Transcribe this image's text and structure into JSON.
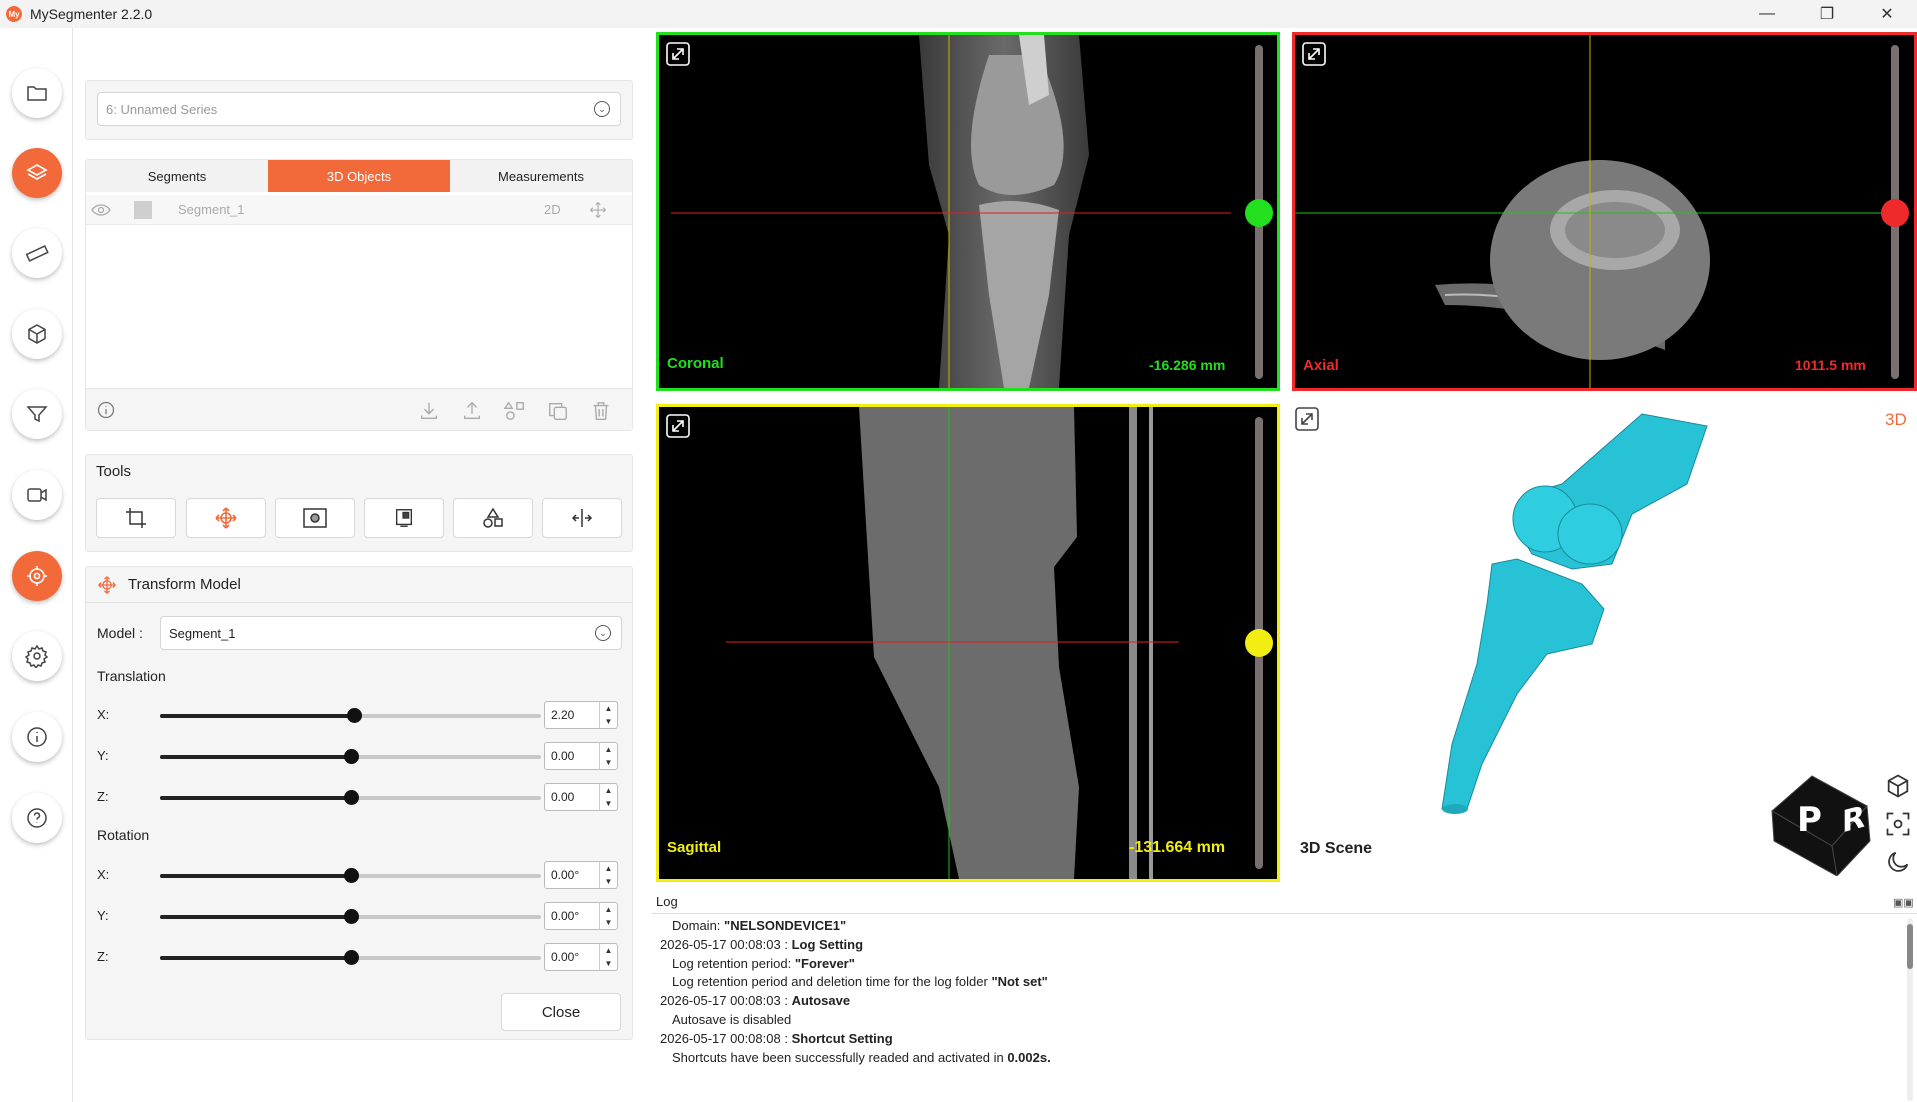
{
  "app": {
    "title": "MySegmenter 2.2.0",
    "logo_text": "My"
  },
  "window_controls": {
    "minimize": "—",
    "restore": "❐",
    "close": "✕"
  },
  "sidebar": {
    "items": [
      "folder-icon",
      "layers-icon",
      "ruler-icon",
      "cube-icon",
      "filter-icon",
      "video-icon",
      "target-icon",
      "gear-icon",
      "info-icon",
      "help-icon"
    ],
    "active": [
      "layers-icon",
      "target-icon"
    ]
  },
  "series": {
    "placeholder": "6: Unnamed Series"
  },
  "tabs": [
    {
      "label": "Segments"
    },
    {
      "label": "3D Objects",
      "active": true
    },
    {
      "label": "Measurements"
    }
  ],
  "objects": [
    {
      "name": "Segment_1",
      "mode": "2D"
    }
  ],
  "tools": {
    "title": "Tools"
  },
  "transform": {
    "title": "Transform Model",
    "model_label": "Model :",
    "model_value": "Segment_1",
    "translation_title": "Translation",
    "rotation_title": "Rotation",
    "translation": [
      {
        "axis": "X:",
        "value": "2.20",
        "pos": 0.51
      },
      {
        "axis": "Y:",
        "value": "0.00",
        "pos": 0.5
      },
      {
        "axis": "Z:",
        "value": "0.00",
        "pos": 0.5
      }
    ],
    "rotation": [
      {
        "axis": "X:",
        "value": "0.00°",
        "pos": 0.5
      },
      {
        "axis": "Y:",
        "value": "0.00°",
        "pos": 0.5
      },
      {
        "axis": "Z:",
        "value": "0.00°",
        "pos": 0.5
      }
    ],
    "close_label": "Close"
  },
  "viewports": {
    "coronal": {
      "label": "Coronal",
      "mm": "-16.286 mm",
      "color": "#22e01e"
    },
    "axial": {
      "label": "Axial",
      "mm": "1011.5 mm",
      "color": "#ee2a2a"
    },
    "sagittal": {
      "label": "Sagittal",
      "mm": "-131.664 mm",
      "color": "#f2ee12"
    },
    "scene3d": {
      "label": "3D Scene",
      "badge": "3D",
      "badge_color": "#f26a3a",
      "cube_letters": [
        "P",
        "R"
      ]
    }
  },
  "log": {
    "title": "Log",
    "lines": [
      {
        "indent": true,
        "text": "Domain: ",
        "bold": "\"NELSONDEVICE1\""
      },
      {
        "indent": false,
        "text": "2026-05-17 00:08:03 : ",
        "bold": "Log Setting"
      },
      {
        "indent": true,
        "text": "Log retention period: ",
        "bold": "\"Forever\""
      },
      {
        "indent": true,
        "text": "Log retention period and deletion time for the log folder ",
        "bold": "\"Not set\""
      },
      {
        "indent": false,
        "text": "2026-05-17 00:08:03 : ",
        "bold": "Autosave"
      },
      {
        "indent": true,
        "text": "Autosave is disabled",
        "bold": ""
      },
      {
        "indent": false,
        "text": "2026-05-17 00:08:08 : ",
        "bold": "Shortcut Setting"
      },
      {
        "indent": true,
        "text": "Shortcuts have been successfully readed and activated in ",
        "bold": "0.002s."
      }
    ]
  }
}
